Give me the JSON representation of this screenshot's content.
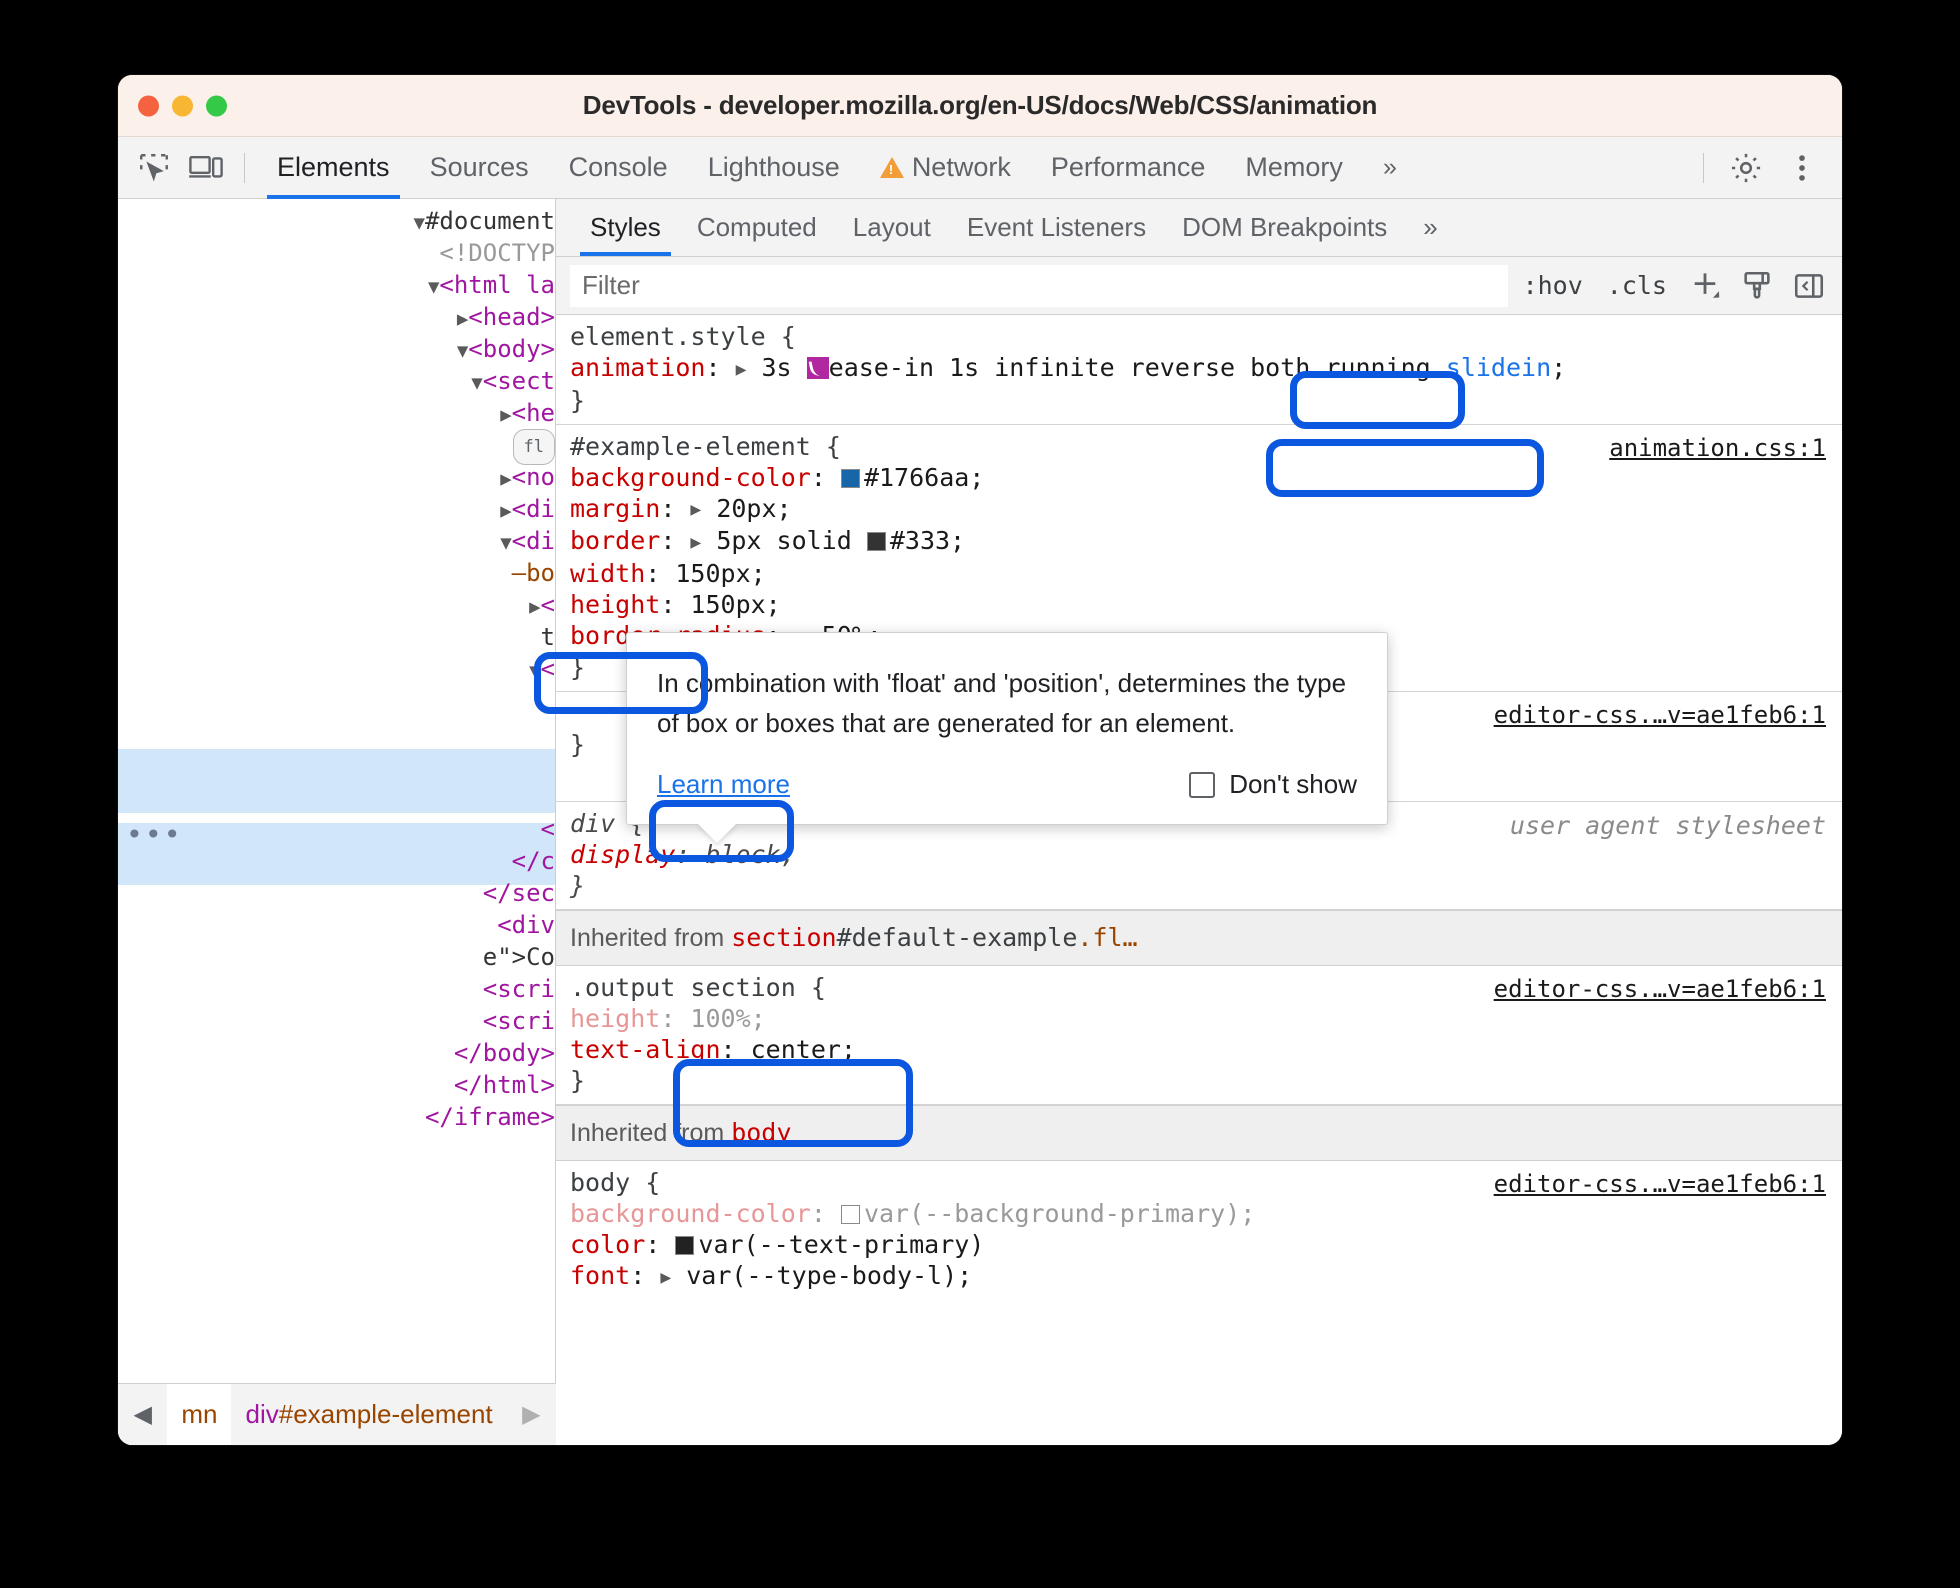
{
  "window": {
    "title": "DevTools - developer.mozilla.org/en-US/docs/Web/CSS/animation"
  },
  "main_toolbar": {
    "inspect_icon": "inspect-element-icon",
    "device_icon": "device-toolbar-icon",
    "tabs": [
      {
        "label": "Elements",
        "active": true
      },
      {
        "label": "Sources",
        "active": false
      },
      {
        "label": "Console",
        "active": false
      },
      {
        "label": "Lighthouse",
        "active": false
      },
      {
        "label": "Network",
        "active": false,
        "warning": true
      },
      {
        "label": "Performance",
        "active": false
      },
      {
        "label": "Memory",
        "active": false
      }
    ],
    "more_tabs": "»",
    "settings_icon": "gear-icon",
    "menu_icon": "kebab-menu-icon"
  },
  "dom_tree": {
    "lines": [
      {
        "indent": 0,
        "marker": "▼",
        "text": "#document",
        "kind": "doc"
      },
      {
        "indent": 1,
        "marker": "",
        "text": "<!DOCTYP",
        "kind": "doctype"
      },
      {
        "indent": 1,
        "marker": "▼",
        "text": "<html la",
        "kind": "tag"
      },
      {
        "indent": 2,
        "marker": "▶",
        "text": "<head>",
        "kind": "tag"
      },
      {
        "indent": 2,
        "marker": "▼",
        "text": "<body>",
        "kind": "tag"
      },
      {
        "indent": 3,
        "marker": "▼",
        "text": "<sect",
        "kind": "tag"
      },
      {
        "indent": 4,
        "marker": "▶",
        "text": "<he",
        "kind": "tag"
      },
      {
        "indent": 5,
        "marker": "",
        "text": "fl",
        "kind": "badge"
      },
      {
        "indent": 4,
        "marker": "▶",
        "text": "<no",
        "kind": "tag"
      },
      {
        "indent": 4,
        "marker": "▶",
        "text": "<di",
        "kind": "tag"
      },
      {
        "indent": 4,
        "marker": "▼",
        "text": "<di",
        "kind": "tag"
      },
      {
        "indent": 5,
        "marker": "",
        "text": "–bo",
        "kind": "attr"
      },
      {
        "indent": 5,
        "marker": "▶",
        "text": "<",
        "kind": "tag"
      },
      {
        "indent": 5,
        "marker": "",
        "text": "t",
        "kind": "txt"
      },
      {
        "indent": 5,
        "marker": "▼",
        "text": "<",
        "kind": "tag"
      },
      {
        "indent": 6,
        "marker": "",
        "text": "",
        "kind": "txt"
      },
      {
        "indent": 6,
        "marker": "",
        "text": "",
        "kind": "txt"
      },
      {
        "indent": 6,
        "marker": "",
        "text": "",
        "kind": "txt"
      },
      {
        "indent": 6,
        "marker": "",
        "text": "",
        "kind": "txt"
      },
      {
        "indent": 5,
        "marker": "",
        "text": "<",
        "kind": "tag"
      },
      {
        "indent": 4,
        "marker": "",
        "text": "</c",
        "kind": "tag"
      },
      {
        "indent": 3,
        "marker": "",
        "text": "</sec",
        "kind": "tag"
      },
      {
        "indent": 3,
        "marker": "",
        "text": "<div",
        "kind": "tag"
      },
      {
        "indent": 3,
        "marker": "",
        "text": "e\">Co",
        "kind": "txt"
      },
      {
        "indent": 3,
        "marker": "",
        "text": "<scri",
        "kind": "tag"
      },
      {
        "indent": 3,
        "marker": "",
        "text": "<scri",
        "kind": "tag"
      },
      {
        "indent": 2,
        "marker": "",
        "text": "</body>",
        "kind": "tag"
      },
      {
        "indent": 1,
        "marker": "",
        "text": "</html>",
        "kind": "tag"
      },
      {
        "indent": 0,
        "marker": "",
        "text": "</iframe>",
        "kind": "tag"
      }
    ]
  },
  "breadcrumb": {
    "left_arrow": "◀",
    "right_arrow": "▶",
    "items": [
      {
        "text": "mn",
        "truncated": true
      },
      {
        "tag": "div",
        "id": "#example-element"
      }
    ]
  },
  "styles_panel": {
    "tabs": [
      {
        "label": "Styles",
        "active": true
      },
      {
        "label": "Computed",
        "active": false
      },
      {
        "label": "Layout",
        "active": false
      },
      {
        "label": "Event Listeners",
        "active": false
      },
      {
        "label": "DOM Breakpoints",
        "active": false
      }
    ],
    "more_tabs": "»",
    "filter_placeholder": "Filter",
    "filter_value": "",
    "hov_label": ":hov",
    "cls_label": ".cls",
    "new_rule_icon": "plus-icon",
    "style_brush_icon": "brush-icon",
    "sidebar_toggle_icon": "sidebar-toggle-icon"
  },
  "rules": {
    "element_style": {
      "selector": "element.style {",
      "close": "}",
      "declarations": [
        {
          "property": "animation",
          "colon": ":",
          "expander": "▶",
          "value_parts": [
            "3s ",
            "ease-in 1s infinite reverse both running "
          ],
          "swatch": "easing-swatch",
          "highlight_value": "slidein",
          "semicolon": ";"
        }
      ]
    },
    "example_element": {
      "selector": "#example-element {",
      "close": "}",
      "origin": "animation.css:1",
      "declarations": [
        {
          "property": "background-color",
          "value": "#1766aa;",
          "swatch": "#1766aa"
        },
        {
          "property": "margin",
          "expander": "▶",
          "value": "20px;"
        },
        {
          "property": "border",
          "expander": "▶",
          "value": "5px solid #333;",
          "swatch": "#333333"
        },
        {
          "property": "width",
          "value": "150px;"
        },
        {
          "property": "height",
          "value": "150px;"
        },
        {
          "property": "border-radius",
          "expander": "▶",
          "value": "50%;"
        }
      ]
    },
    "hidden_rule": {
      "close": "}",
      "origin": "editor-css.…v=ae1feb6:1"
    },
    "div_ua": {
      "selector": "div {",
      "close": "}",
      "origin": "user agent stylesheet",
      "declarations": [
        {
          "property": "display",
          "value": "block;"
        }
      ]
    },
    "inherited_section": {
      "label": "Inherited from",
      "tag": "section",
      "rest": "#default-example",
      "cls": ".fl…"
    },
    "output_section": {
      "selector": ".output section {",
      "close": "}",
      "origin": "editor-css.…v=ae1feb6:1",
      "declarations": [
        {
          "property": "height",
          "value": "100%;",
          "dim": true
        },
        {
          "property": "text-align",
          "value": "center;"
        }
      ]
    },
    "inherited_body": {
      "label": "Inherited from",
      "tag": "body"
    },
    "body_rule": {
      "selector": "body {",
      "origin": "editor-css.…v=ae1feb6:1",
      "declarations": [
        {
          "property": "background-color",
          "value": "var(--background-primary);",
          "dim": true,
          "swatch": "#ffffff"
        },
        {
          "property": "color",
          "value_prefix": "v",
          "value": "ar(--text-primary)",
          "swatch": "#222222"
        },
        {
          "property": "font",
          "expander": "▶",
          "value_prefix": "va",
          "value": "r(--type-body-l);"
        }
      ]
    }
  },
  "tooltip": {
    "text": "In combination with 'float' and 'position', determines the type of box or boxes that are generated for an element.",
    "learn_more": "Learn more",
    "dont_show": "Don't show",
    "checkbox_checked": false
  },
  "annotations": {
    "color": "#0b57e0",
    "boxes": [
      {
        "name": "slidein-annotation"
      },
      {
        "name": "animation-css-origin-annotation"
      },
      {
        "name": "learn-more-annotation"
      },
      {
        "name": "section-selector-annotation"
      },
      {
        "name": "css-vars-annotation"
      }
    ]
  }
}
